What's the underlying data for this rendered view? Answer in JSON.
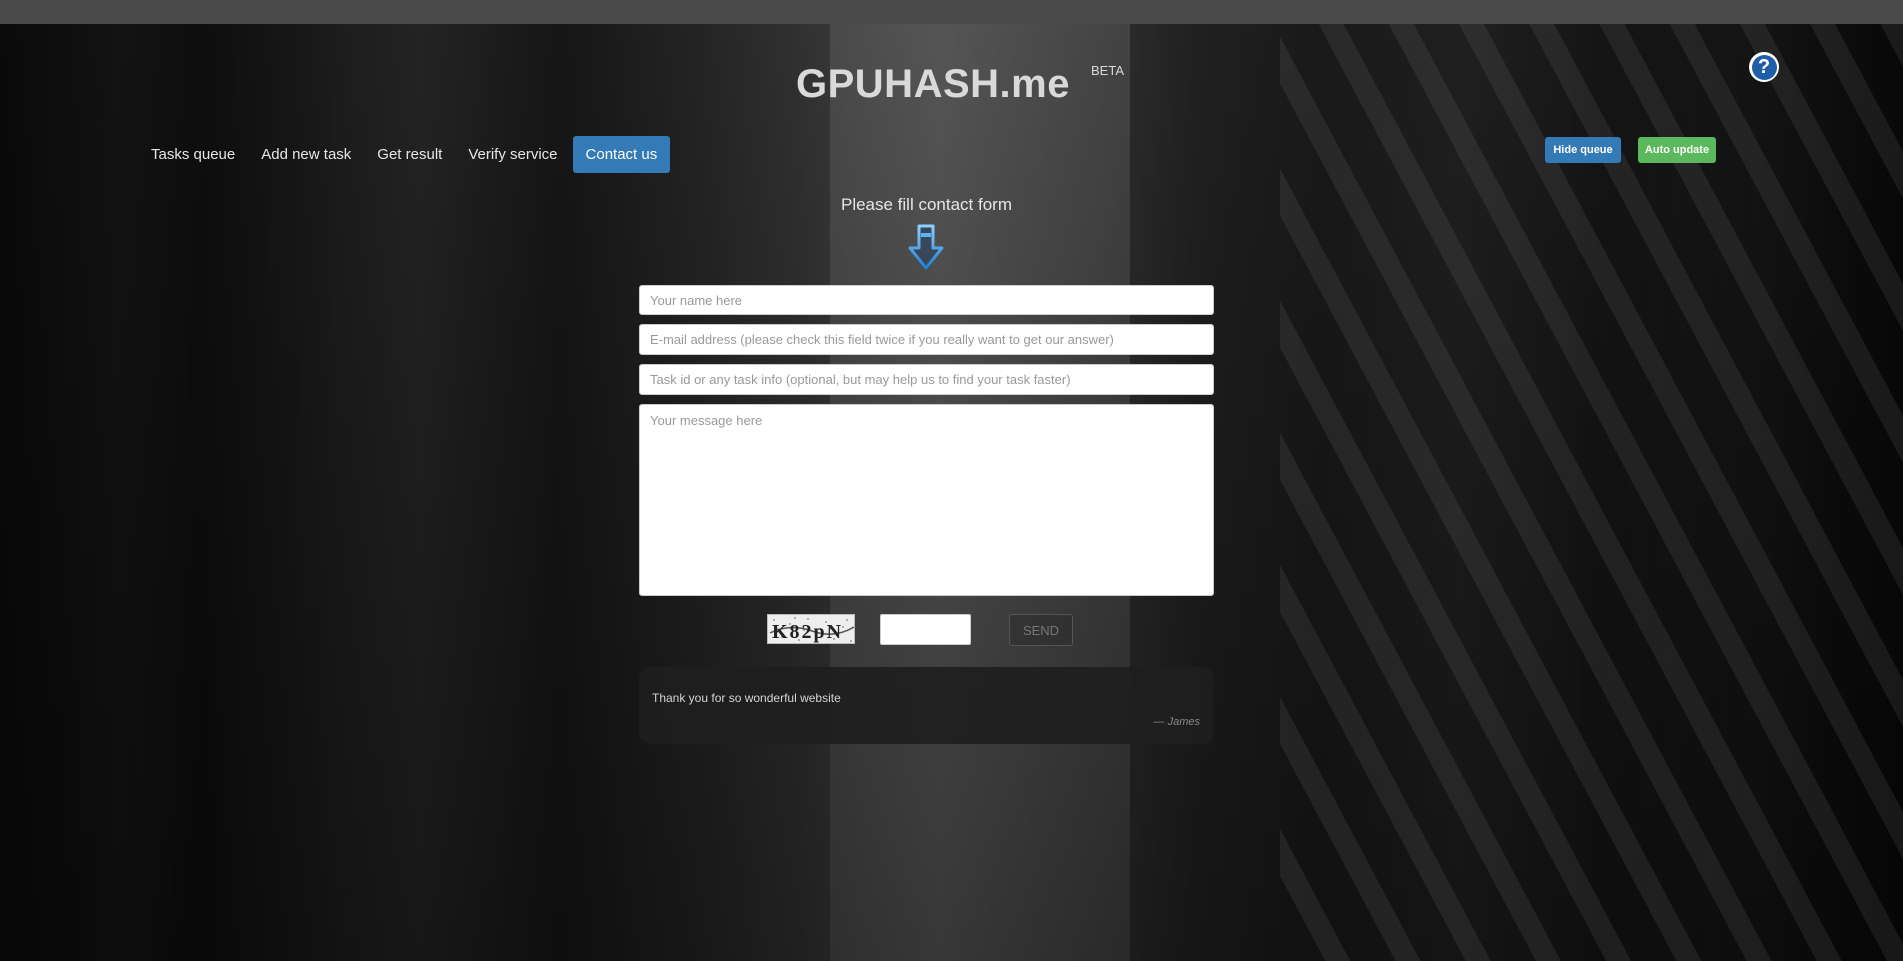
{
  "header": {
    "logo": "GPUHASH.me",
    "badge": "BETA",
    "help_glyph": "?"
  },
  "nav": {
    "items": [
      {
        "label": "Tasks queue"
      },
      {
        "label": "Add new task"
      },
      {
        "label": "Get result"
      },
      {
        "label": "Verify service"
      },
      {
        "label": "Contact us",
        "active": true
      }
    ]
  },
  "actions": {
    "hide_queue": "Hide queue",
    "auto_update": "Auto update"
  },
  "form": {
    "title": "Please fill contact form",
    "name_placeholder": "Your name here",
    "email_placeholder": "E-mail address (please check this field twice if you really want to get our answer)",
    "task_placeholder": "Task id or any task info (optional, but may help us to find your task faster)",
    "message_placeholder": "Your message here",
    "captcha_text": "K82pN",
    "captcha_value": "",
    "send_label": "SEND"
  },
  "testimonial": {
    "text": "Thank you for so wonderful website",
    "author": "— James"
  },
  "colors": {
    "primary": "#337ab7",
    "success": "#5cb85c",
    "topbar": "#4b4b4b"
  },
  "icons": {
    "help": "question-circle-icon",
    "arrow": "down-arrow-icon"
  }
}
